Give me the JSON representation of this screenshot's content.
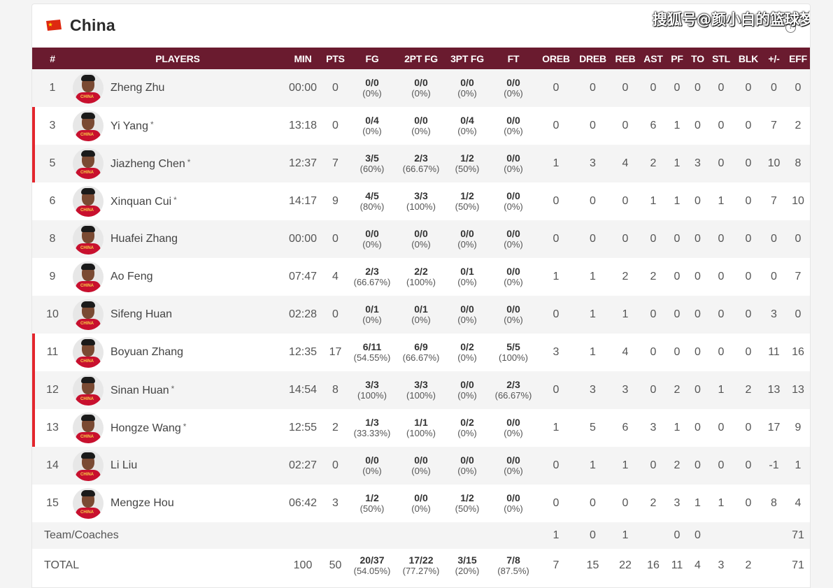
{
  "team": {
    "name": "China",
    "flag_icon": "china-flag-icon"
  },
  "watermark": "搜狐号@颜小白的篮球梦",
  "help_icon": "?",
  "colors": {
    "header_bg": "#6a1b2f",
    "starter_marker": "#e3262d",
    "jersey": "#c8102e"
  },
  "columns": [
    "#",
    "PLAYERS",
    "MIN",
    "PTS",
    "FG",
    "2PT FG",
    "3PT FG",
    "FT",
    "OREB",
    "DREB",
    "REB",
    "AST",
    "PF",
    "TO",
    "STL",
    "BLK",
    "+/-",
    "EFF"
  ],
  "players": [
    {
      "num": "1",
      "name": "Zheng Zhu",
      "starter": false,
      "min": "00:00",
      "pts": "0",
      "fg": "0/0",
      "fg_pct": "(0%)",
      "p2": "0/0",
      "p2_pct": "(0%)",
      "p3": "0/0",
      "p3_pct": "(0%)",
      "ft": "0/0",
      "ft_pct": "(0%)",
      "oreb": "0",
      "dreb": "0",
      "reb": "0",
      "ast": "0",
      "pf": "0",
      "to": "0",
      "stl": "0",
      "blk": "0",
      "pm": "0",
      "eff": "0"
    },
    {
      "num": "3",
      "name": "Yi Yang",
      "starter": true,
      "star": "*",
      "min": "13:18",
      "pts": "0",
      "fg": "0/4",
      "fg_pct": "(0%)",
      "p2": "0/0",
      "p2_pct": "(0%)",
      "p3": "0/4",
      "p3_pct": "(0%)",
      "ft": "0/0",
      "ft_pct": "(0%)",
      "oreb": "0",
      "dreb": "0",
      "reb": "0",
      "ast": "6",
      "pf": "1",
      "to": "0",
      "stl": "0",
      "blk": "0",
      "pm": "7",
      "eff": "2"
    },
    {
      "num": "5",
      "name": "Jiazheng Chen",
      "starter": true,
      "star": "*",
      "min": "12:37",
      "pts": "7",
      "fg": "3/5",
      "fg_pct": "(60%)",
      "p2": "2/3",
      "p2_pct": "(66.67%)",
      "p3": "1/2",
      "p3_pct": "(50%)",
      "ft": "0/0",
      "ft_pct": "(0%)",
      "oreb": "1",
      "dreb": "3",
      "reb": "4",
      "ast": "2",
      "pf": "1",
      "to": "3",
      "stl": "0",
      "blk": "0",
      "pm": "10",
      "eff": "8"
    },
    {
      "num": "6",
      "name": "Xinquan Cui",
      "starter": false,
      "star": "*",
      "min": "14:17",
      "pts": "9",
      "fg": "4/5",
      "fg_pct": "(80%)",
      "p2": "3/3",
      "p2_pct": "(100%)",
      "p3": "1/2",
      "p3_pct": "(50%)",
      "ft": "0/0",
      "ft_pct": "(0%)",
      "oreb": "0",
      "dreb": "0",
      "reb": "0",
      "ast": "1",
      "pf": "1",
      "to": "0",
      "stl": "1",
      "blk": "0",
      "pm": "7",
      "eff": "10"
    },
    {
      "num": "8",
      "name": "Huafei Zhang",
      "starter": false,
      "min": "00:00",
      "pts": "0",
      "fg": "0/0",
      "fg_pct": "(0%)",
      "p2": "0/0",
      "p2_pct": "(0%)",
      "p3": "0/0",
      "p3_pct": "(0%)",
      "ft": "0/0",
      "ft_pct": "(0%)",
      "oreb": "0",
      "dreb": "0",
      "reb": "0",
      "ast": "0",
      "pf": "0",
      "to": "0",
      "stl": "0",
      "blk": "0",
      "pm": "0",
      "eff": "0"
    },
    {
      "num": "9",
      "name": "Ao Feng",
      "starter": false,
      "min": "07:47",
      "pts": "4",
      "fg": "2/3",
      "fg_pct": "(66.67%)",
      "p2": "2/2",
      "p2_pct": "(100%)",
      "p3": "0/1",
      "p3_pct": "(0%)",
      "ft": "0/0",
      "ft_pct": "(0%)",
      "oreb": "1",
      "dreb": "1",
      "reb": "2",
      "ast": "2",
      "pf": "0",
      "to": "0",
      "stl": "0",
      "blk": "0",
      "pm": "0",
      "eff": "7"
    },
    {
      "num": "10",
      "name": "Sifeng Huan",
      "starter": false,
      "min": "02:28",
      "pts": "0",
      "fg": "0/1",
      "fg_pct": "(0%)",
      "p2": "0/1",
      "p2_pct": "(0%)",
      "p3": "0/0",
      "p3_pct": "(0%)",
      "ft": "0/0",
      "ft_pct": "(0%)",
      "oreb": "0",
      "dreb": "1",
      "reb": "1",
      "ast": "0",
      "pf": "0",
      "to": "0",
      "stl": "0",
      "blk": "0",
      "pm": "3",
      "eff": "0"
    },
    {
      "num": "11",
      "name": "Boyuan Zhang",
      "starter": true,
      "min": "12:35",
      "pts": "17",
      "fg": "6/11",
      "fg_pct": "(54.55%)",
      "p2": "6/9",
      "p2_pct": "(66.67%)",
      "p3": "0/2",
      "p3_pct": "(0%)",
      "ft": "5/5",
      "ft_pct": "(100%)",
      "oreb": "3",
      "dreb": "1",
      "reb": "4",
      "ast": "0",
      "pf": "0",
      "to": "0",
      "stl": "0",
      "blk": "0",
      "pm": "11",
      "eff": "16"
    },
    {
      "num": "12",
      "name": "Sinan Huan",
      "starter": true,
      "star": "*",
      "min": "14:54",
      "pts": "8",
      "fg": "3/3",
      "fg_pct": "(100%)",
      "p2": "3/3",
      "p2_pct": "(100%)",
      "p3": "0/0",
      "p3_pct": "(0%)",
      "ft": "2/3",
      "ft_pct": "(66.67%)",
      "oreb": "0",
      "dreb": "3",
      "reb": "3",
      "ast": "0",
      "pf": "2",
      "to": "0",
      "stl": "1",
      "blk": "2",
      "pm": "13",
      "eff": "13"
    },
    {
      "num": "13",
      "name": "Hongze Wang",
      "starter": true,
      "star": "*",
      "min": "12:55",
      "pts": "2",
      "fg": "1/3",
      "fg_pct": "(33.33%)",
      "p2": "1/1",
      "p2_pct": "(100%)",
      "p3": "0/2",
      "p3_pct": "(0%)",
      "ft": "0/0",
      "ft_pct": "(0%)",
      "oreb": "1",
      "dreb": "5",
      "reb": "6",
      "ast": "3",
      "pf": "1",
      "to": "0",
      "stl": "0",
      "blk": "0",
      "pm": "17",
      "eff": "9"
    },
    {
      "num": "14",
      "name": "Li Liu",
      "starter": false,
      "min": "02:27",
      "pts": "0",
      "fg": "0/0",
      "fg_pct": "(0%)",
      "p2": "0/0",
      "p2_pct": "(0%)",
      "p3": "0/0",
      "p3_pct": "(0%)",
      "ft": "0/0",
      "ft_pct": "(0%)",
      "oreb": "0",
      "dreb": "1",
      "reb": "1",
      "ast": "0",
      "pf": "2",
      "to": "0",
      "stl": "0",
      "blk": "0",
      "pm": "-1",
      "eff": "1"
    },
    {
      "num": "15",
      "name": "Mengze Hou",
      "starter": false,
      "min": "06:42",
      "pts": "3",
      "fg": "1/2",
      "fg_pct": "(50%)",
      "p2": "0/0",
      "p2_pct": "(0%)",
      "p3": "1/2",
      "p3_pct": "(50%)",
      "ft": "0/0",
      "ft_pct": "(0%)",
      "oreb": "0",
      "dreb": "0",
      "reb": "0",
      "ast": "2",
      "pf": "3",
      "to": "1",
      "stl": "1",
      "blk": "0",
      "pm": "8",
      "eff": "4"
    }
  ],
  "team_coaches": {
    "label": "Team/Coaches",
    "oreb": "1",
    "dreb": "0",
    "reb": "1",
    "pf": "0",
    "to": "0",
    "eff": "71"
  },
  "total": {
    "label": "TOTAL",
    "min": "100",
    "pts": "50",
    "fg": "20/37",
    "fg_pct": "(54.05%)",
    "p2": "17/22",
    "p2_pct": "(77.27%)",
    "p3": "3/15",
    "p3_pct": "(20%)",
    "ft": "7/8",
    "ft_pct": "(87.5%)",
    "oreb": "7",
    "dreb": "15",
    "reb": "22",
    "ast": "16",
    "pf": "11",
    "to": "4",
    "stl": "3",
    "blk": "2",
    "pm": "",
    "eff": "71"
  }
}
